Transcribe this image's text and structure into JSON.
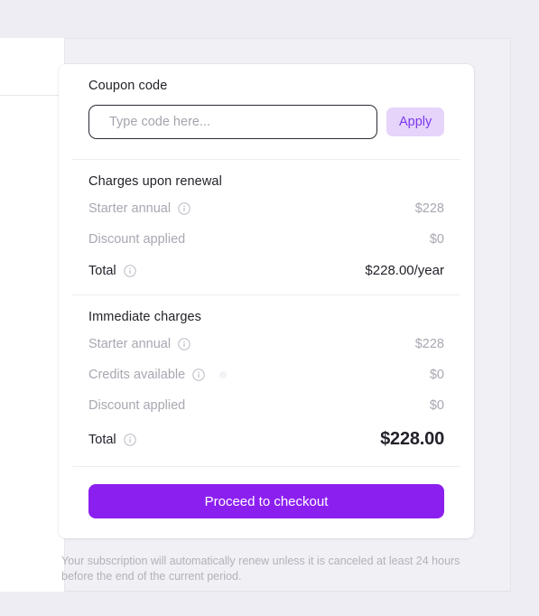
{
  "coupon": {
    "label": "Coupon code",
    "placeholder": "Type code here...",
    "value": "",
    "apply_label": "Apply"
  },
  "renewal": {
    "title": "Charges upon renewal",
    "items": [
      {
        "label": "Starter annual",
        "value": "$228",
        "has_info": true
      },
      {
        "label": "Discount applied",
        "value": "$0",
        "has_info": false
      }
    ],
    "total": {
      "label": "Total",
      "value": "$228.00/year",
      "has_info": true
    }
  },
  "immediate": {
    "title": "Immediate charges",
    "items": [
      {
        "label": "Starter annual",
        "value": "$228",
        "has_info": true
      },
      {
        "label": "Credits available",
        "value": "$0",
        "has_info": true
      },
      {
        "label": "Discount applied",
        "value": "$0",
        "has_info": false
      }
    ],
    "total": {
      "label": "Total",
      "value": "$228.00",
      "has_info": true
    }
  },
  "checkout": {
    "label": "Proceed to checkout"
  },
  "footer": {
    "note": "Your subscription will automatically renew unless it is canceled at least 24 hours before the end of the current period."
  },
  "icons": {
    "info": "info-circle-icon"
  },
  "colors": {
    "accent": "#8b1ff0",
    "apply_bg": "#e6d4fb",
    "apply_text": "#7c3aec",
    "muted_text": "#a9a7b1",
    "strong_text": "#23222a",
    "page_bg": "#eeedf3",
    "panel_bg": "#f1f0f4",
    "card_bg": "#ffffff"
  }
}
